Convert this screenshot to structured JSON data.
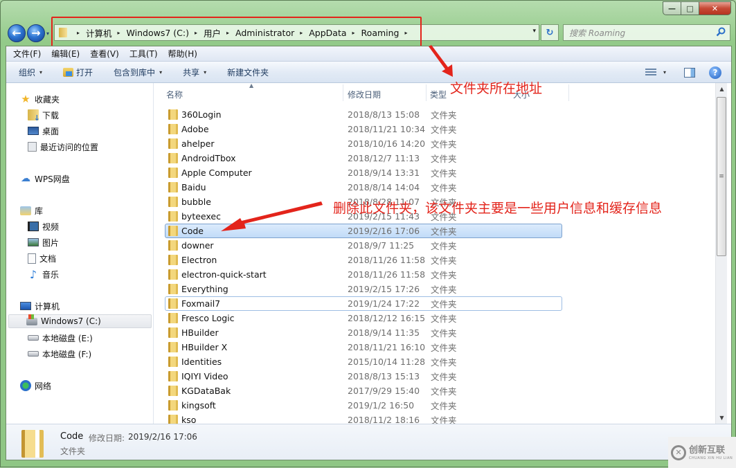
{
  "window": {
    "caption_buttons": {
      "minimize": "—",
      "maximize": "□",
      "close": "✕"
    }
  },
  "nav": {
    "back_icon": "←",
    "forward_icon": "→",
    "history_dropdown_icon": "▾",
    "address": {
      "breadcrumbs": [
        "计算机",
        "Windows7 (C:)",
        "用户",
        "Administrator",
        "AppData",
        "Roaming"
      ],
      "separator": "▸",
      "dropdown_icon": "▾"
    },
    "refresh_icon": "↻",
    "search": {
      "placeholder": "搜索 Roaming"
    }
  },
  "menubar": {
    "items": [
      "文件(F)",
      "编辑(E)",
      "查看(V)",
      "工具(T)",
      "帮助(H)"
    ]
  },
  "toolbar": {
    "organize": "组织",
    "open": "打开",
    "include_in_library": "包含到库中",
    "share": "共享",
    "new_folder": "新建文件夹",
    "caret": "▾",
    "help": "?"
  },
  "sidebar": {
    "favorites": {
      "label": "收藏夹",
      "items": [
        "下载",
        "桌面",
        "最近访问的位置"
      ]
    },
    "wps": {
      "label": "WPS网盘"
    },
    "libraries": {
      "label": "库",
      "items": [
        "视频",
        "图片",
        "文档",
        "音乐"
      ]
    },
    "computer": {
      "label": "计算机",
      "items": [
        "Windows7 (C:)",
        "本地磁盘 (E:)",
        "本地磁盘 (F:)"
      ],
      "selected": "Windows7 (C:)"
    },
    "network": {
      "label": "网络"
    }
  },
  "columns": {
    "name": "名称",
    "modified": "修改日期",
    "type": "类型",
    "size": "大小",
    "sort_indicator": "▲"
  },
  "files": [
    {
      "name": "360Login",
      "modified": "2018/8/13 15:08",
      "type": "文件夹"
    },
    {
      "name": "Adobe",
      "modified": "2018/11/21 10:34",
      "type": "文件夹"
    },
    {
      "name": "ahelper",
      "modified": "2018/10/16 14:20",
      "type": "文件夹"
    },
    {
      "name": "AndroidTbox",
      "modified": "2018/12/7 11:13",
      "type": "文件夹"
    },
    {
      "name": "Apple Computer",
      "modified": "2018/9/14 13:31",
      "type": "文件夹"
    },
    {
      "name": "Baidu",
      "modified": "2018/8/14 14:04",
      "type": "文件夹"
    },
    {
      "name": "bubble",
      "modified": "2018/8/28 11:07",
      "type": "文件夹"
    },
    {
      "name": "byteexec",
      "modified": "2019/2/15 11:43",
      "type": "文件夹"
    },
    {
      "name": "Code",
      "modified": "2019/2/16 17:06",
      "type": "文件夹",
      "state": "selected"
    },
    {
      "name": "downer",
      "modified": "2018/9/7 11:25",
      "type": "文件夹"
    },
    {
      "name": "Electron",
      "modified": "2018/11/26 11:58",
      "type": "文件夹"
    },
    {
      "name": "electron-quick-start",
      "modified": "2018/11/26 11:58",
      "type": "文件夹"
    },
    {
      "name": "Everything",
      "modified": "2019/2/15 17:26",
      "type": "文件夹"
    },
    {
      "name": "Foxmail7",
      "modified": "2019/1/24 17:22",
      "type": "文件夹",
      "state": "focused"
    },
    {
      "name": "Fresco Logic",
      "modified": "2018/12/12 16:15",
      "type": "文件夹"
    },
    {
      "name": "HBuilder",
      "modified": "2018/9/14 11:35",
      "type": "文件夹"
    },
    {
      "name": "HBuilder X",
      "modified": "2018/11/21 16:10",
      "type": "文件夹"
    },
    {
      "name": "Identities",
      "modified": "2015/10/14 11:28",
      "type": "文件夹"
    },
    {
      "name": "IQIYI Video",
      "modified": "2018/8/13 15:13",
      "type": "文件夹"
    },
    {
      "name": "KGDataBak",
      "modified": "2017/9/29 15:40",
      "type": "文件夹"
    },
    {
      "name": "kingsoft",
      "modified": "2019/1/2 16:50",
      "type": "文件夹"
    },
    {
      "name": "kso",
      "modified": "2018/11/2 18:16",
      "type": "文件夹"
    }
  ],
  "scrollbar": {
    "up": "▲",
    "down": "▼",
    "grip": "≡",
    "position_fraction": 0.0
  },
  "details": {
    "name": "Code",
    "modified_label": "修改日期:",
    "modified_value": "2019/2/16 17:06",
    "type": "文件夹"
  },
  "annotations": {
    "address_note": "文件夹所在地址",
    "delete_note": "删除此文件夹，该文件夹主要是一些用户信息和缓存信息",
    "color": "#e3241b"
  },
  "watermark": {
    "logo": "✕",
    "text": "创新互联",
    "sub": "CHUANG XIN HU LIAN"
  }
}
